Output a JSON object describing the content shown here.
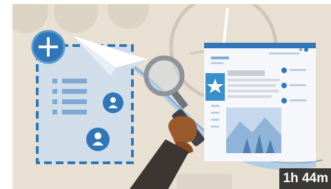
{
  "course_card": {
    "duration": "1h 44m",
    "colors": {
      "background": "#e8e0d2",
      "primary_blue": "#2f77b8",
      "light_blue": "#d7e6f3",
      "hand": "#9a5a2b",
      "sleeve": "#3c3531"
    },
    "icons": [
      "plus-icon",
      "person-icon",
      "star-icon",
      "magnifying-glass-icon",
      "paper-plane-icon",
      "clock-icon"
    ]
  }
}
